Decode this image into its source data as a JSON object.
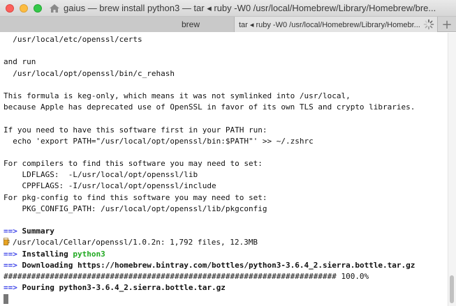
{
  "window": {
    "title": "gaius — brew install python3 — tar ◂ ruby -W0 /usr/local/Homebrew/Library/Homebrew/bre..."
  },
  "tabs": [
    {
      "label": "brew"
    },
    {
      "label": "tar ◂ ruby -W0 /usr/local/Homebrew/Library/Homebr..."
    }
  ],
  "new_tab_label": "+",
  "icons": {
    "title": "home-folder-icon",
    "loading": "spinner-icon",
    "summary": "beer-mug-icon"
  },
  "terminal": {
    "lines": [
      "  /usr/local/etc/openssl/certs",
      "",
      "and run",
      "  /usr/local/opt/openssl/bin/c_rehash",
      "",
      "This formula is keg-only, which means it was not symlinked into /usr/local,",
      "because Apple has deprecated use of OpenSSL in favor of its own TLS and crypto libraries.",
      "",
      "If you need to have this software first in your PATH run:",
      "  echo 'export PATH=\"/usr/local/opt/openssl/bin:$PATH\"' >> ~/.zshrc",
      "",
      "For compilers to find this software you may need to set:",
      "    LDFLAGS:  -L/usr/local/opt/openssl/lib",
      "    CPPFLAGS: -I/usr/local/opt/openssl/include",
      "For pkg-config to find this software you may need to set:",
      "    PKG_CONFIG_PATH: /usr/local/opt/openssl/lib/pkgconfig",
      ""
    ],
    "arrow": "==>",
    "summary_label": "Summary",
    "summary_detail": "/usr/local/Cellar/openssl/1.0.2n: 1,792 files, 12.3MB",
    "installing_label": "Installing",
    "installing_pkg": "python3",
    "downloading_label": "Downloading https://homebrew.bintray.com/bottles/python3-3.6.4_2.sierra.bottle.tar.gz",
    "progress_bar": "######################################################################## 100.0%",
    "pouring_label": "Pouring python3-3.6.4_2.sierra.bottle.tar.gz"
  },
  "colors": {
    "arrow": "#3d44e8",
    "package": "#1fa81f"
  }
}
